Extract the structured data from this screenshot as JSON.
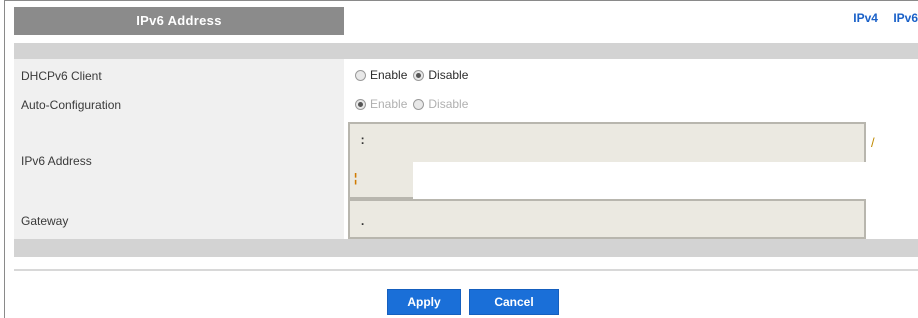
{
  "header": {
    "title": "IPv6 Address",
    "links": [
      "IPv4",
      "IPv6"
    ]
  },
  "rows": {
    "dhcp": {
      "label": "DHCPv6 Client",
      "options": [
        {
          "label": "Enable",
          "checked": false,
          "muted": false
        },
        {
          "label": "Disable",
          "checked": true,
          "muted": false
        }
      ]
    },
    "autoconfig": {
      "label": "Auto-Configuration",
      "options": [
        {
          "label": "Enable",
          "checked": true,
          "muted": true
        },
        {
          "label": "Disable",
          "checked": false,
          "muted": true
        }
      ]
    },
    "address": {
      "label": "IPv6 Address",
      "value_separator": ":",
      "prefix_separator": "/"
    },
    "gateway": {
      "label": "Gateway",
      "value_separator": "."
    }
  },
  "buttons": {
    "apply": "Apply",
    "cancel": "Cancel"
  },
  "colors": {
    "title_bg": "#8b8b8b",
    "accent": "#1a6fd8",
    "link": "#1a61c8",
    "field_bg": "#ebe9e1"
  }
}
